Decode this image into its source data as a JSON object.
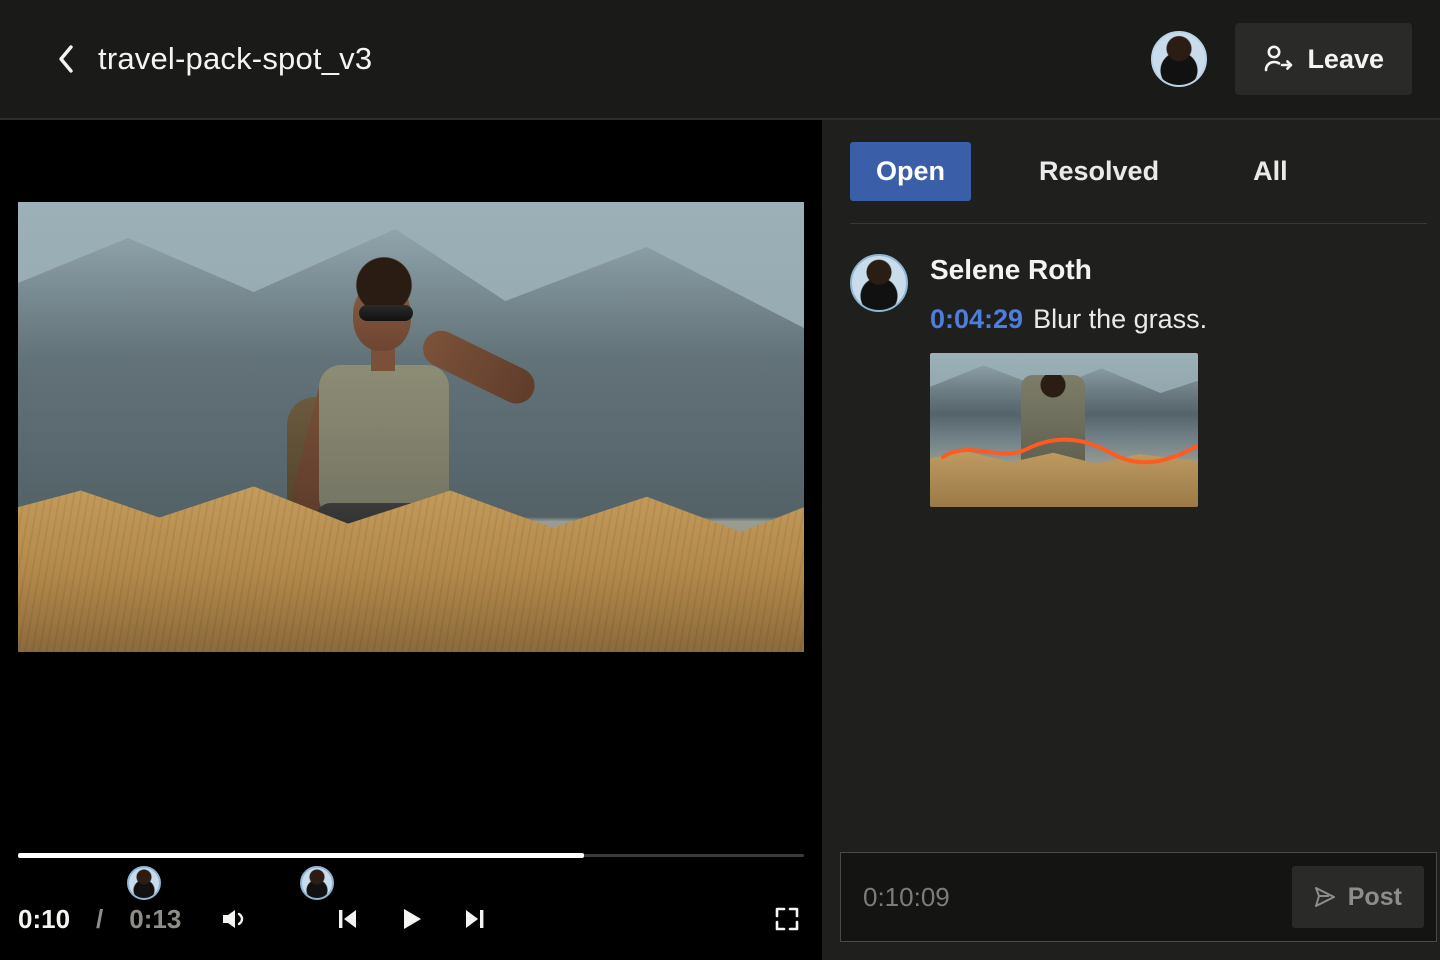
{
  "header": {
    "title": "travel-pack-spot_v3",
    "leave_label": "Leave"
  },
  "player": {
    "current_time": "0:10",
    "duration": "0:13",
    "progress_pct": 72,
    "markers": [
      {
        "pct": 16
      },
      {
        "pct": 38
      }
    ]
  },
  "tabs": {
    "open": "Open",
    "resolved": "Resolved",
    "all": "All",
    "active": "open"
  },
  "comment": {
    "author": "Selene Roth",
    "timestamp": "0:04:29",
    "text": "Blur the grass."
  },
  "composer": {
    "timestamp": "0:10:09",
    "placeholder": "",
    "post_label": "Post"
  },
  "colors": {
    "accent": "#3a5fa8",
    "link": "#4e7dde",
    "annotation": "#ff5a1f"
  }
}
